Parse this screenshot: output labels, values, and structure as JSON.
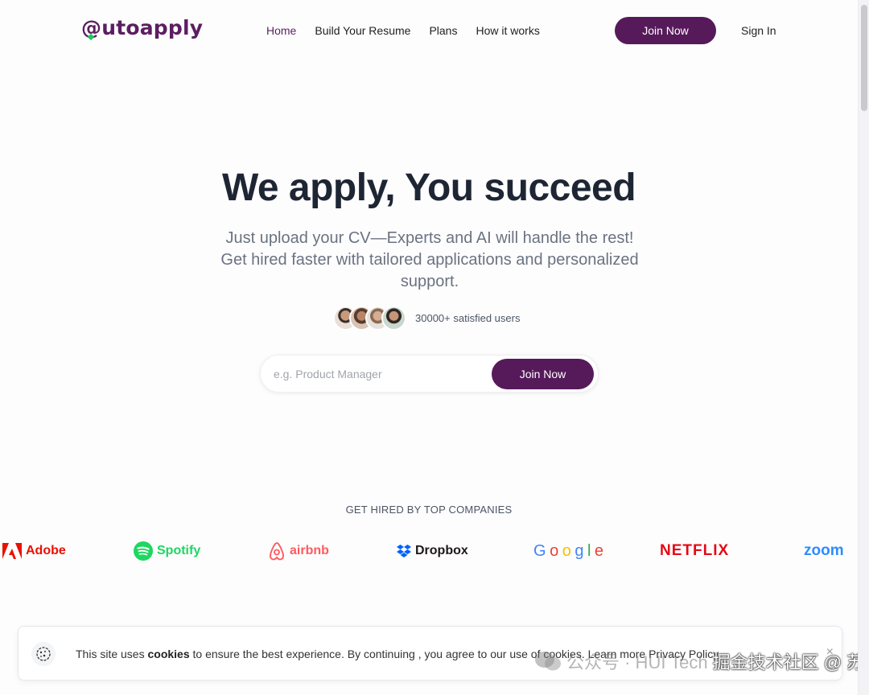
{
  "brand": {
    "logo_text": "@utoapply",
    "primary_color": "#561a5a",
    "accent_color": "#22c55e"
  },
  "nav": {
    "links": [
      {
        "label": "Home",
        "active": true
      },
      {
        "label": "Build Your Resume",
        "active": false
      },
      {
        "label": "Plans",
        "active": false
      },
      {
        "label": "How it works",
        "active": false
      }
    ],
    "join_label": "Join Now",
    "signin_label": "Sign In"
  },
  "hero": {
    "title": "We apply, You succeed",
    "subtitle": "Just upload your CV—Experts and AI will handle the rest! Get hired faster with tailored applications and personalized support.",
    "users_text": "30000+ satisfied users",
    "search_placeholder": "e.g. Product Manager",
    "search_value": "",
    "join_label": "Join Now"
  },
  "companies": {
    "title": "GET HIRED BY TOP COMPANIES",
    "logos": [
      {
        "name": "Adobe",
        "icon": "adobe-icon",
        "color": "#eb1000"
      },
      {
        "name": "Spotify",
        "icon": "spotify-icon",
        "color": "#1ed760"
      },
      {
        "name": "airbnb",
        "icon": "airbnb-icon",
        "color": "#ff5a5f"
      },
      {
        "name": "Dropbox",
        "icon": "dropbox-icon",
        "color": "#0061fe"
      },
      {
        "name": "Google",
        "icon": "google-wordmark",
        "color": "#4285f4"
      },
      {
        "name": "NETFLIX",
        "icon": "netflix-wordmark",
        "color": "#e50914"
      },
      {
        "name": "zoom",
        "icon": "zoom-wordmark",
        "color": "#2d8cff"
      }
    ]
  },
  "cookie_banner": {
    "text_before": "This site uses ",
    "text_bold": "cookies",
    "text_after": " to ensure the best experience. By continuing , you agree to our use of cookies.",
    "link_learn_more": "Learn more",
    "link_privacy": "Privacy Policy",
    "close_glyph": "×"
  },
  "watermark": {
    "text_faded": "公众号 · HUI Tech",
    "text_strong": "掘金技术社区 @ 苏瑾深"
  }
}
